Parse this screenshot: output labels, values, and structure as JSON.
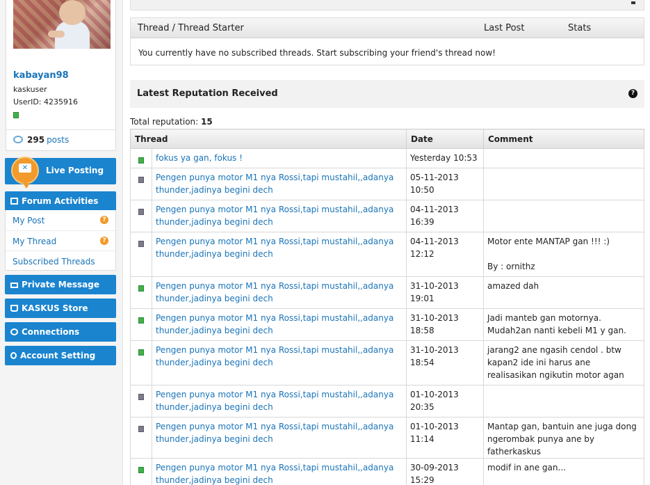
{
  "profile": {
    "username": "kabayan98",
    "usergroup": "kaskuser",
    "userid": "UserID: 4235916",
    "posts_count": "295",
    "posts_label": "posts"
  },
  "sidebar": {
    "live_posting": "Live Posting",
    "forum_activities": "Forum Activities",
    "forum_items": [
      "My Post",
      "My Thread",
      "Subscribed Threads"
    ],
    "private_message": "Private Message",
    "kaskus_store": "KASKUS Store",
    "connections": "Connections",
    "account_setting": "Account Setting"
  },
  "subscribed": {
    "col_thread": "Thread / Thread Starter",
    "col_last_post": "Last Post",
    "col_stats": "Stats",
    "empty_message": "You currently have no subscribed threads. Start subscribing your friend's thread now!"
  },
  "reputation": {
    "title": "Latest Reputation Received",
    "total_label": "Total reputation:",
    "total_value": "15",
    "columns": [
      "Thread",
      "Date",
      "Comment"
    ],
    "rows": [
      {
        "status": "positive",
        "thread": "fokus ya gan, fokus !",
        "date": "Yesterday 10:53",
        "comment": ""
      },
      {
        "status": "neutral",
        "thread": "Pengen punya motor M1 nya Rossi,tapi mustahil,,adanya thunder,jadinya begini dech",
        "date": "05-11-2013 10:50",
        "comment": ""
      },
      {
        "status": "neutral",
        "thread": "Pengen punya motor M1 nya Rossi,tapi mustahil,,adanya thunder,jadinya begini dech",
        "date": "04-11-2013 16:39",
        "comment": ""
      },
      {
        "status": "neutral",
        "thread": "Pengen punya motor M1 nya Rossi,tapi mustahil,,adanya thunder,jadinya begini dech",
        "date": "04-11-2013 12:12",
        "comment": "Motor ente MANTAP gan !!! :)\n\nBy : ornithz"
      },
      {
        "status": "positive",
        "thread": "Pengen punya motor M1 nya Rossi,tapi mustahil,,adanya thunder,jadinya begini dech",
        "date": "31-10-2013 19:01",
        "comment": "amazed dah"
      },
      {
        "status": "positive",
        "thread": "Pengen punya motor M1 nya Rossi,tapi mustahil,,adanya thunder,jadinya begini dech",
        "date": "31-10-2013 18:58",
        "comment": "Jadi manteb gan motornya. Mudah2an nanti kebeli M1 y gan."
      },
      {
        "status": "positive",
        "thread": "Pengen punya motor M1 nya Rossi,tapi mustahil,,adanya thunder,jadinya begini dech",
        "date": "31-10-2013 18:54",
        "comment": "jarang2 ane ngasih cendol . btw kapan2 ide ini harus ane realisasikan ngikutin motor agan"
      },
      {
        "status": "neutral",
        "thread": "Pengen punya motor M1 nya Rossi,tapi mustahil,,adanya thunder,jadinya begini dech",
        "date": "01-10-2013 20:35",
        "comment": ""
      },
      {
        "status": "neutral",
        "thread": "Pengen punya motor M1 nya Rossi,tapi mustahil,,adanya thunder,jadinya begini dech",
        "date": "01-10-2013 11:14",
        "comment": "Mantap gan, bantuin ane juga dong ngerombak punya ane by fatherkaskus"
      },
      {
        "status": "positive",
        "thread": "Pengen punya motor M1 nya Rossi,tapi mustahil,,adanya thunder,jadinya begini dech",
        "date": "30-09-2013 15:29",
        "comment": "modif in ane gan..."
      }
    ]
  }
}
